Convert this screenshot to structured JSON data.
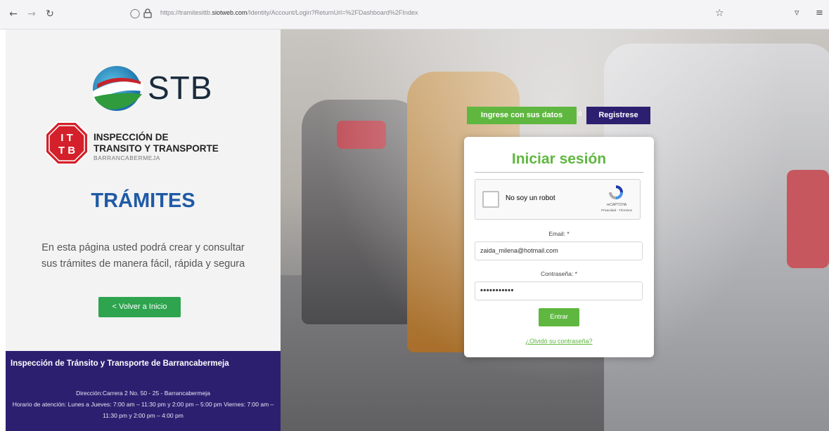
{
  "browser": {
    "url_prefix": "https://tramitesittb.",
    "url_domain": "siotweb.com",
    "url_path": "/Identity/Account/Login?ReturnUrl=%2FDashboard%2FIndex"
  },
  "left": {
    "stb_logo_text": "STB",
    "itt_badge_top": "I T",
    "itt_badge_bottom": "T B",
    "itt_line1": "INSPECCIÓN DE",
    "itt_line2": "TRANSITO Y TRANSPORTE",
    "itt_line3": "BARRANCABERMEJA",
    "heading": "TRÁMITES",
    "description": "En esta página usted podrá crear y consultar sus trámites de manera fácil, rápida y segura",
    "back_button": "< Volver a Inicio",
    "footer_title": "Inspección de Tránsito y Transporte de Barrancabermeja",
    "footer_address": "Dirección:Carrera 2 No. 50 - 25 - Barrancabermeja",
    "footer_hours": "Horario de atención: Lunes a Jueves: 7:00 am – 11:30 pm y 2:00 pm – 5:00 pm Viernes: 7:00 am – 11:30 pm y 2:00 pm – 4:00 pm"
  },
  "tabs": {
    "login": "Ingrese con sus datos",
    "separator": "ó",
    "register": "Registrese"
  },
  "login": {
    "title": "Iniciar sesión",
    "captcha_label": "No soy un robot",
    "captcha_brand": "reCAPTCHA",
    "captcha_terms": "Privacidad - Términos",
    "email_label": "Email: *",
    "email_value": "zaida_milena@hotmail.com",
    "password_label": "Contraseña: *",
    "password_value": "•••••••••••",
    "submit": "Entrar",
    "forgot": "¿Olvidó su contraseña?"
  },
  "colors": {
    "green": "#5fb740",
    "purple": "#2d1f70",
    "blue": "#1f5aa6",
    "itt_red": "#d3202a"
  }
}
